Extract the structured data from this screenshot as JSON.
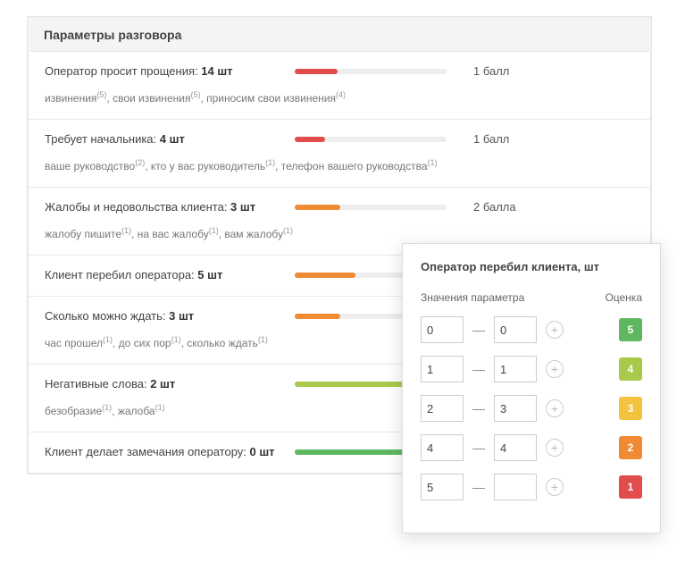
{
  "panelTitle": "Параметры разговора",
  "items": [
    {
      "label": "Оператор просит прощения:",
      "count": "14 шт",
      "barWidth": "28%",
      "barColor": "#e24c4b",
      "score": "1 балл",
      "details": [
        {
          "t": "извинения",
          "n": "(5)"
        },
        {
          "t": ", свои извинения",
          "n": "(5)"
        },
        {
          "t": ", приносим свои извинения",
          "n": "(4)"
        }
      ]
    },
    {
      "label": "Требует начальника:",
      "count": "4 шт",
      "barWidth": "20%",
      "barColor": "#e24c4b",
      "score": "1 балл",
      "details": [
        {
          "t": "ваше руководство",
          "n": "(2)"
        },
        {
          "t": ", кто у вас руководитель",
          "n": "(1)"
        },
        {
          "t": ", телефон вашего руководства",
          "n": "(1)"
        }
      ]
    },
    {
      "label": "Жалобы и недовольства клиента:",
      "count": "3 шт",
      "barWidth": "30%",
      "barColor": "#f08a33",
      "score": "2 балла",
      "details": [
        {
          "t": "жалобу пишите",
          "n": "(1)"
        },
        {
          "t": ", на вас жалобу",
          "n": "(1)"
        },
        {
          "t": ", вам жалобу",
          "n": "(1)"
        }
      ]
    },
    {
      "label": "Клиент перебил оператора:",
      "count": "5 шт",
      "barWidth": "40%",
      "barColor": "#f08a33",
      "score": "",
      "details": []
    },
    {
      "label": "Сколько можно ждать:",
      "count": "3 шт",
      "barWidth": "30%",
      "barColor": "#f08a33",
      "score": "",
      "details": [
        {
          "t": "час прошел",
          "n": "(1)"
        },
        {
          "t": ", до сих пор",
          "n": "(1)"
        },
        {
          "t": ", сколько ждать",
          "n": "(1)"
        }
      ]
    },
    {
      "label": "Негативные слова:",
      "count": "2 шт",
      "barWidth": "100%",
      "barColor": "#a8c94a",
      "score": "",
      "details": [
        {
          "t": "безобразие",
          "n": "(1)"
        },
        {
          "t": ", жалоба",
          "n": "(1)"
        }
      ]
    },
    {
      "label": "Клиент делает замечания оператору:",
      "count": "0 шт",
      "barWidth": "100%",
      "barColor": "#5fb85f",
      "score": "",
      "details": []
    }
  ],
  "popup": {
    "title": "Оператор перебил клиента, шт",
    "colValues": "Значения параметра",
    "colScore": "Оценка",
    "rows": [
      {
        "from": "0",
        "to": "0",
        "badge": "5",
        "color": "#5fb85f"
      },
      {
        "from": "1",
        "to": "1",
        "badge": "4",
        "color": "#a8c94a"
      },
      {
        "from": "2",
        "to": "3",
        "badge": "3",
        "color": "#f3c23e"
      },
      {
        "from": "4",
        "to": "4",
        "badge": "2",
        "color": "#f08a33"
      },
      {
        "from": "5",
        "to": "",
        "badge": "1",
        "color": "#e24c4b"
      }
    ]
  }
}
